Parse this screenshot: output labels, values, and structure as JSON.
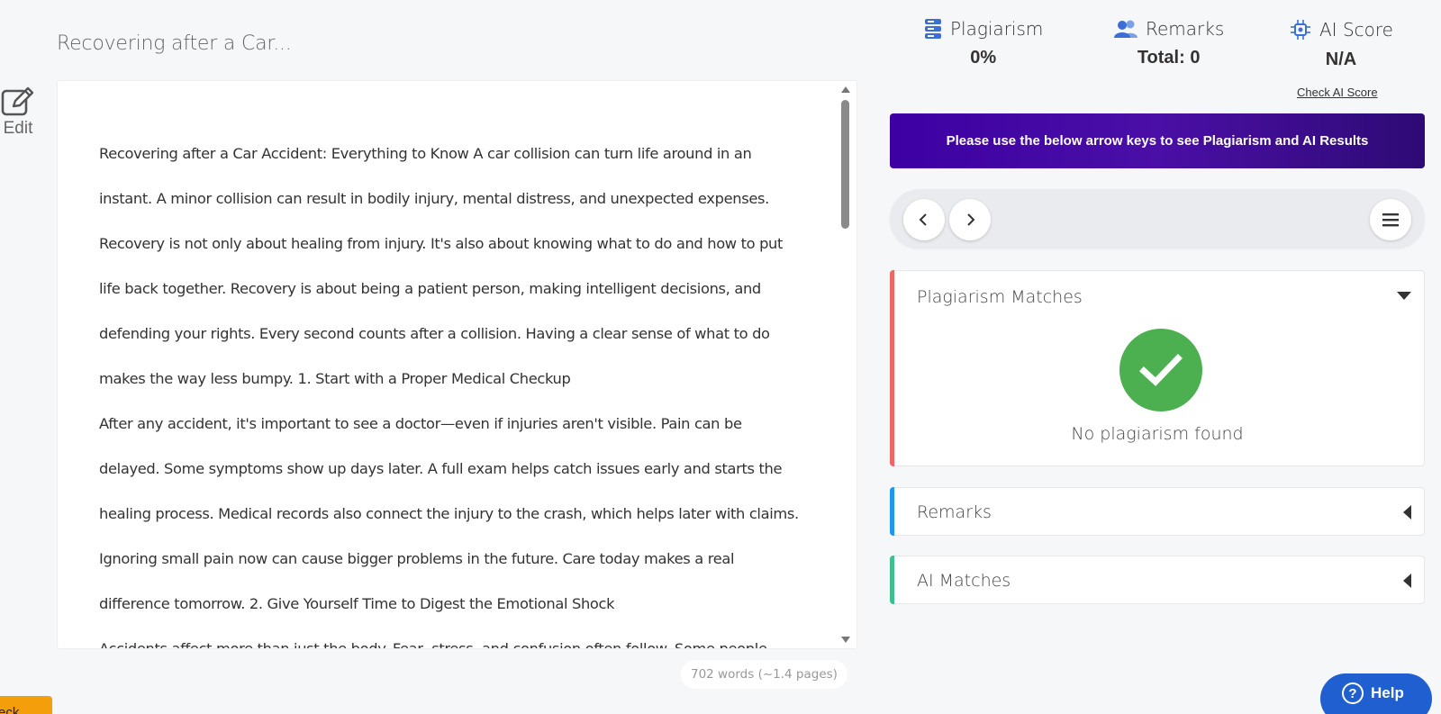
{
  "document": {
    "title": "Recovering after a Car...",
    "paragraphs": [
      "Recovering after a Car Accident: Everything to Know A car collision can turn life around in an instant. A minor collision can result in bodily injury, mental distress, and unexpected expenses. Recovery is not only about healing from injury. It's also about knowing what to do and how to put life back together. Recovery is about being a patient person, making intelligent decisions, and defending your rights. Every second counts after a collision. Having a clear sense of what to do makes the way less bumpy. 1. Start with a Proper Medical Checkup",
      "After any accident, it's important to see a doctor—even if injuries aren't visible. Pain can be delayed. Some symptoms show up days later. A full exam helps catch issues early and starts the healing process. Medical records also connect the injury to the crash, which helps later with claims. Ignoring small pain now can cause bigger problems in the future. Care today makes a real difference tomorrow. 2. Give Yourself Time to Digest the Emotional Shock",
      "Accidents affect more than just the body. Fear, stress, and confusion often follow. Some people relive"
    ],
    "word_count": "702 words (~1.4 pages)"
  },
  "edit": {
    "label": "Edit",
    "icon": "edit-icon"
  },
  "stats": {
    "plagiarism": {
      "label": "Plagiarism",
      "value": "0%",
      "icon": "database-icon",
      "color": "#3b6fd6"
    },
    "remarks": {
      "label": "Remarks",
      "value": "Total: 0",
      "icon": "users-icon",
      "color": "#3b6fd6"
    },
    "ai_score": {
      "label": "AI Score",
      "value": "N/A",
      "icon": "ai-chip-icon",
      "color": "#3b6fd6"
    },
    "check_ai_link": "Check AI Score"
  },
  "banner": {
    "text": "Please use the below arrow keys to see Plagiarism and AI Results",
    "color": "#3d00a3"
  },
  "nav": {
    "prev_icon": "chevron-left-icon",
    "next_icon": "chevron-right-icon",
    "menu_icon": "menu-icon"
  },
  "panels": {
    "plagiarism": {
      "title": "Plagiarism Matches",
      "status": "No plagiarism found",
      "accent": "#ef6666",
      "expanded": true
    },
    "remarks": {
      "title": "Remarks",
      "accent": "#2196f3",
      "expanded": false
    },
    "ai": {
      "title": "AI Matches",
      "accent": "#3fbf8f",
      "expanded": false
    }
  },
  "help": {
    "label": "Help",
    "icon": "question-icon"
  },
  "check_badge": {
    "label": "eck"
  }
}
